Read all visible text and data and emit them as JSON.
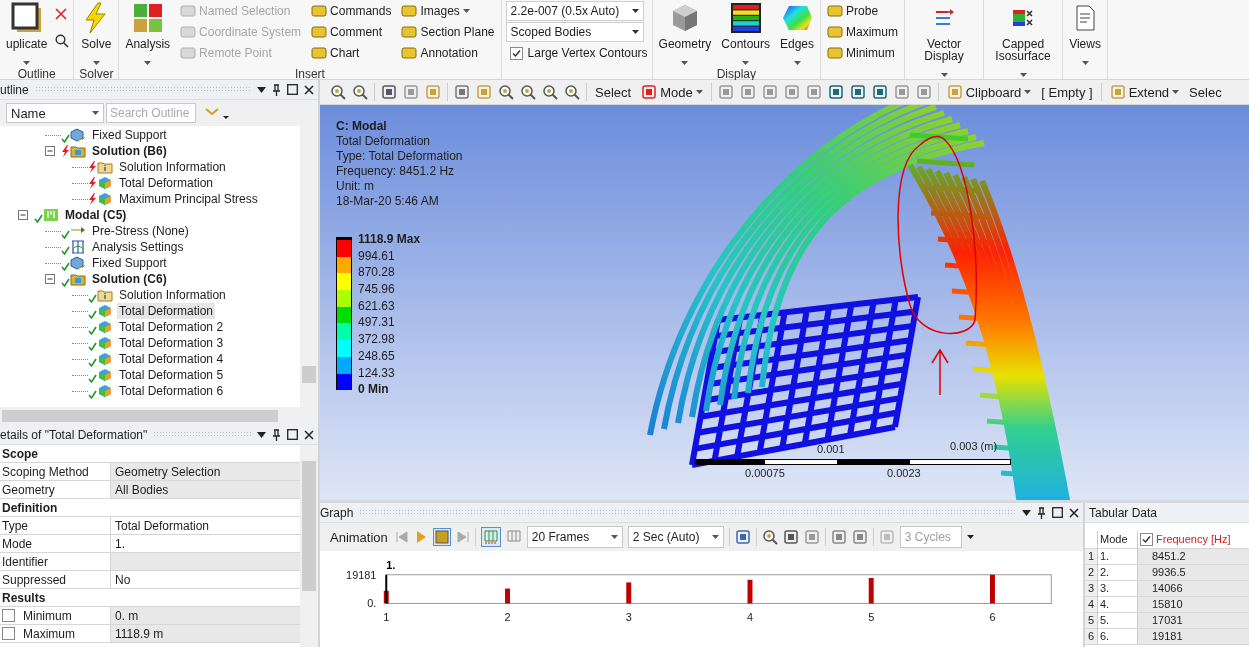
{
  "ribbon": {
    "groups": [
      {
        "label": "Outline",
        "blocks": [
          {
            "kind": "large",
            "label": "uplicate"
          },
          {
            "kind": "tools"
          }
        ]
      },
      {
        "label": "Solver",
        "blocks": [
          {
            "kind": "large",
            "label": "Solve"
          }
        ]
      },
      {
        "label": "Insert",
        "blocks": [
          {
            "kind": "large",
            "label": "Analysis"
          },
          {
            "kind": "stack",
            "items": [
              {
                "kind": "small",
                "label": "Named Selection",
                "disabled": true
              },
              {
                "kind": "small",
                "label": "Coordinate System",
                "disabled": true
              },
              {
                "kind": "small",
                "label": "Remote Point",
                "disabled": true
              }
            ]
          },
          {
            "kind": "stack",
            "items": [
              {
                "kind": "small",
                "label": "Commands",
                "disabled": false
              },
              {
                "kind": "small",
                "label": "Comment",
                "disabled": false
              },
              {
                "kind": "small",
                "label": "Chart",
                "disabled": false
              }
            ]
          },
          {
            "kind": "stack",
            "items": [
              {
                "kind": "menu",
                "label": "Images",
                "disabled": false
              },
              {
                "kind": "small",
                "label": "Section Plane",
                "disabled": false
              },
              {
                "kind": "small",
                "label": "Annotation",
                "disabled": false
              }
            ]
          }
        ]
      },
      {
        "blocks": [
          {
            "kind": "stack",
            "items": [
              {
                "kind": "combo",
                "label": "2.2e-007 (0.5x Auto)"
              },
              {
                "kind": "combo",
                "label": "Scoped Bodies"
              },
              {
                "kind": "checkbox",
                "label": "Large Vertex Contours",
                "checked": true
              }
            ]
          }
        ]
      },
      {
        "label": "Display",
        "blocks": [
          {
            "kind": "large",
            "label": "Geometry"
          },
          {
            "kind": "large",
            "label": "Contours"
          },
          {
            "kind": "large",
            "label": "Edges"
          }
        ]
      },
      {
        "blocks": [
          {
            "kind": "stack",
            "items": [
              {
                "kind": "small",
                "label": "Probe",
                "disabled": false
              },
              {
                "kind": "small",
                "label": "Maximum",
                "disabled": false
              },
              {
                "kind": "small",
                "label": "Minimum",
                "disabled": false
              }
            ]
          }
        ]
      },
      {
        "blocks": [
          {
            "kind": "large",
            "label": "Vector Display"
          }
        ]
      },
      {
        "blocks": [
          {
            "kind": "large",
            "label": "Capped Isosurface"
          }
        ]
      },
      {
        "blocks": [
          {
            "kind": "large",
            "label": "Views"
          }
        ]
      }
    ]
  },
  "outline": {
    "title": "utline",
    "filter": "Name",
    "search": {
      "placeholder": "Search Outline"
    },
    "tree": [
      {
        "children": [
          {
            "label": "Fixed Support",
            "kind": "support",
            "solved": true,
            "selected": false
          },
          {
            "label": "Solution (B6)",
            "kind": "solution",
            "solved": false,
            "selected": false,
            "expanded": true,
            "children": [
              {
                "label": "Solution Information",
                "kind": "info",
                "solved": false,
                "selected": false
              },
              {
                "label": "Total Deformation",
                "kind": "result",
                "solved": false,
                "selected": false
              },
              {
                "label": "Maximum Principal Stress",
                "kind": "result",
                "solved": false,
                "selected": false
              }
            ]
          }
        ]
      },
      {
        "label": "Modal (C5)",
        "kind": "analysis",
        "solved": true,
        "selected": false,
        "expanded": true,
        "children": [
          {
            "label": "Pre-Stress (None)",
            "kind": "prestress",
            "solved": true,
            "selected": false
          },
          {
            "label": "Analysis Settings",
            "kind": "settings",
            "solved": true,
            "selected": false
          },
          {
            "label": "Fixed Support",
            "kind": "support",
            "solved": true,
            "selected": false
          },
          {
            "label": "Solution (C6)",
            "kind": "solution",
            "solved": true,
            "selected": false,
            "expanded": true,
            "children": [
              {
                "label": "Solution Information",
                "kind": "info",
                "solved": true,
                "selected": false
              },
              {
                "label": "Total Deformation",
                "kind": "result",
                "solved": true,
                "selected": true
              },
              {
                "label": "Total Deformation 2",
                "kind": "result",
                "solved": true,
                "selected": false
              },
              {
                "label": "Total Deformation 3",
                "kind": "result",
                "solved": true,
                "selected": false
              },
              {
                "label": "Total Deformation 4",
                "kind": "result",
                "solved": true,
                "selected": false
              },
              {
                "label": "Total Deformation 5",
                "kind": "result",
                "solved": true,
                "selected": false
              },
              {
                "label": "Total Deformation 6",
                "kind": "result",
                "solved": true,
                "selected": false
              }
            ]
          }
        ]
      }
    ]
  },
  "details": {
    "title": "etails of \"Total Deformation\"",
    "rows": [
      {
        "kind": "section",
        "label": "Scope"
      },
      {
        "kind": "field",
        "label": "Scoping Method",
        "value": "Geometry Selection",
        "readonly": true
      },
      {
        "kind": "field",
        "label": "Geometry",
        "value": "All Bodies",
        "readonly": true
      },
      {
        "kind": "section",
        "label": "Definition"
      },
      {
        "kind": "field",
        "label": "Type",
        "value": "Total Deformation",
        "readonly": false
      },
      {
        "kind": "field",
        "label": "Mode",
        "value": "1.",
        "readonly": false
      },
      {
        "kind": "field",
        "label": "Identifier",
        "readonly": true
      },
      {
        "kind": "field",
        "label": "Suppressed",
        "value": "No",
        "readonly": false
      },
      {
        "kind": "section",
        "label": "Results"
      },
      {
        "kind": "check",
        "label": "Minimum",
        "value": "0. m",
        "readonly": true,
        "checked": false
      },
      {
        "kind": "check",
        "label": "Maximum",
        "value": "1118.9 m",
        "readonly": true,
        "checked": false
      }
    ]
  },
  "view_toolbar": {
    "tools": [
      {
        "label": "Select",
        "dropdown": false
      },
      {
        "label": "Mode",
        "dropdown": true
      },
      {
        "label": "Clipboard",
        "dropdown": true
      },
      {
        "label": "[ Empty ]",
        "dropdown": false
      },
      {
        "label": "Extend",
        "dropdown": true
      },
      {
        "label": "Selec",
        "dropdown": false
      }
    ]
  },
  "viewport": {
    "title": "C: Modal",
    "lines": [
      "Total Deformation",
      "Type: Total Deformation",
      "Frequency: 8451.2 Hz",
      "Unit: m",
      "18-Mar-20 5:46 AM"
    ],
    "legend": {
      "labels": [
        "1118.9 Max",
        "994.61",
        "870.28",
        "745.96",
        "621.63",
        "497.31",
        "372.98",
        "248.65",
        "124.33",
        "0 Min"
      ],
      "bands": [
        {
          "color": "#ff0000"
        },
        {
          "color": "#ffaa00"
        },
        {
          "color": "#ffff00"
        },
        {
          "color": "#aaff00"
        },
        {
          "color": "#00dd00"
        },
        {
          "color": "#00ffaa"
        },
        {
          "color": "#00ffff"
        },
        {
          "color": "#00aaff"
        },
        {
          "color": "#0000ff"
        }
      ]
    },
    "scale_bar": {
      "top_labels": [
        "0.001",
        "0.003 (m)"
      ],
      "bottom_labels": [
        "0.00075",
        "0.0023"
      ]
    }
  },
  "graph": {
    "title": "Graph",
    "animation": "Animation",
    "frames": "20 Frames",
    "duration": "2 Sec (Auto)",
    "cycles": {
      "value": "3 Cycles",
      "disabled": true
    },
    "chart_data": {
      "type": "bar",
      "categories": [
        "1",
        "2",
        "3",
        "4",
        "5",
        "6"
      ],
      "values": [
        8451.2,
        9936.5,
        14066,
        15810,
        17031,
        19181
      ],
      "ylim": [
        0,
        19181
      ],
      "yticks": [
        {
          "value": 0,
          "label": "0."
        },
        19181
      ],
      "annotations": [
        "1."
      ]
    }
  },
  "tabular": {
    "title": "Tabular Data",
    "columns": [
      {
        "label": "Mode",
        "checkbox": false
      },
      {
        "label": "Frequency [Hz]",
        "checkbox": true,
        "checked": true
      }
    ],
    "rows": [
      {
        "index": "1",
        "mode": "1.",
        "frequency": "8451.2"
      },
      {
        "index": "2",
        "mode": "2.",
        "frequency": "9936.5"
      },
      {
        "index": "3",
        "mode": "3.",
        "frequency": "14066"
      },
      {
        "index": "4",
        "mode": "4.",
        "frequency": "15810"
      },
      {
        "index": "5",
        "mode": "5.",
        "frequency": "17031"
      },
      {
        "index": "6",
        "mode": "6.",
        "frequency": "19181"
      }
    ]
  }
}
